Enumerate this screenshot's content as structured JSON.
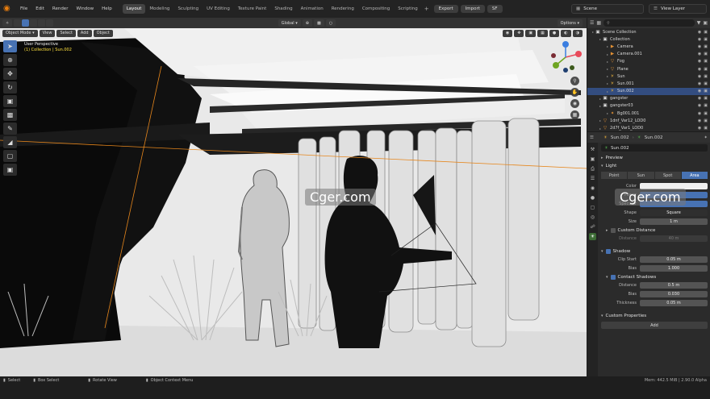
{
  "topbar": {
    "menus": [
      "File",
      "Edit",
      "Render",
      "Window",
      "Help"
    ],
    "workspaces": [
      "Layout",
      "Modeling",
      "Sculpting",
      "UV Editing",
      "Texture Paint",
      "Shading",
      "Animation",
      "Rendering",
      "Compositing",
      "Scripting"
    ],
    "active_workspace": "Layout",
    "export_label": "Export",
    "import_label": "Import",
    "sf_label": "SF",
    "scene_label": "Scene",
    "view_layer_label": "View Layer"
  },
  "viewport": {
    "mode": "Object Mode",
    "menu": [
      "View",
      "Select",
      "Add",
      "Object"
    ],
    "transform": "Global",
    "options": "Options",
    "overlay_line1": "User Perspective",
    "overlay_line2": "(1) Collection | Sun.002"
  },
  "watermark": "Cger.com",
  "outliner": {
    "search_placeholder": "",
    "rows": [
      {
        "label": "Scene Collection",
        "icon": "collection-icon",
        "indent": 0,
        "selected": false
      },
      {
        "label": "Collection",
        "icon": "collection-icon",
        "indent": 1,
        "selected": false
      },
      {
        "label": "Camera",
        "icon": "camera-icon",
        "indent": 2,
        "selected": false
      },
      {
        "label": "Camera.001",
        "icon": "camera-icon",
        "indent": 2,
        "selected": false
      },
      {
        "label": "Fog",
        "icon": "mesh-icon",
        "indent": 2,
        "selected": false
      },
      {
        "label": "Plane",
        "icon": "mesh-icon",
        "indent": 2,
        "selected": false
      },
      {
        "label": "Sun",
        "icon": "light-icon",
        "indent": 2,
        "selected": false
      },
      {
        "label": "Sun.001",
        "icon": "light-icon",
        "indent": 2,
        "selected": false
      },
      {
        "label": "Sun.002",
        "icon": "light-icon",
        "indent": 2,
        "selected": true
      },
      {
        "label": "gangster",
        "icon": "collection-icon",
        "indent": 1,
        "selected": false
      },
      {
        "label": "gangster03",
        "icon": "collection-icon",
        "indent": 1,
        "selected": false
      },
      {
        "label": "Bg001.001",
        "icon": "armature-icon",
        "indent": 2,
        "selected": false
      },
      {
        "label": "1dnf_Var12_LOD0",
        "icon": "mesh-icon",
        "indent": 1,
        "selected": false
      },
      {
        "label": "2d7f_Var1_LOD0",
        "icon": "mesh-icon",
        "indent": 1,
        "selected": false
      }
    ]
  },
  "properties": {
    "object_name": "Sun.002",
    "data_name": "Sun.002",
    "datablock": "Sun.002",
    "preview_label": "Preview",
    "light_label": "Light",
    "light_types": [
      "Point",
      "Sun",
      "Spot",
      "Area"
    ],
    "active_light_type": "Area",
    "color_label": "Color",
    "power_label": "Power",
    "specular_label": "Specular",
    "shape_label": "Shape",
    "shape_value": "Square",
    "size_label": "Size",
    "size_value": "1 m",
    "custom_distance_label": "Custom Distance",
    "distance_label": "Distance",
    "distance_value": "40 m",
    "shadow_label": "Shadow",
    "clip_start_label": "Clip Start",
    "clip_start_value": "0.05 m",
    "bias_label": "Bias",
    "bias_value": "1.000",
    "contact_shadows_label": "Contact Shadows",
    "cs_distance_label": "Distance",
    "cs_distance_value": "0.5 m",
    "cs_bias_label": "Bias",
    "cs_bias_value": "0.030",
    "thickness_label": "Thickness",
    "thickness_value": "0.05 m",
    "custom_properties_label": "Custom Properties",
    "add_label": "Add"
  },
  "statusbar": {
    "select": "Select",
    "box_select": "Box Select",
    "rotate_view": "Rotate View",
    "context_menu": "Object Context Menu",
    "stats": "Mem: 442.5 MiB | 2.90.0 Alpha"
  },
  "colors": {
    "accent": "#4772b3",
    "selected_row": "#334d80",
    "light_icon": "#d9a53b",
    "mesh_icon": "#e39134"
  }
}
